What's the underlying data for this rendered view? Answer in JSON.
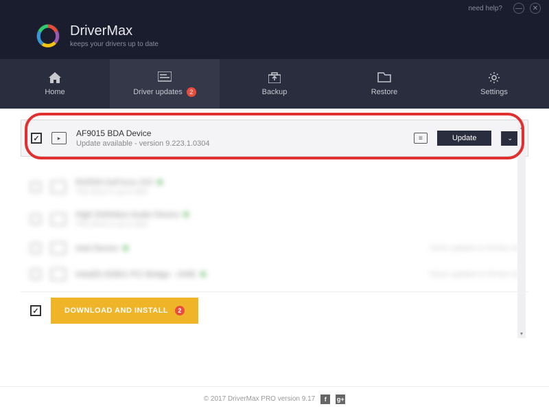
{
  "titlebar": {
    "help": "need help?"
  },
  "brand": {
    "title": "DriverMax",
    "subtitle": "keeps your drivers up to date"
  },
  "nav": {
    "items": [
      {
        "label": "Home"
      },
      {
        "label": "Driver updates",
        "badge": "2"
      },
      {
        "label": "Backup"
      },
      {
        "label": "Restore"
      },
      {
        "label": "Settings"
      }
    ]
  },
  "main_driver": {
    "name": "AF9015 BDA Device",
    "status": "Update available - version 9.223.1.0304",
    "update_label": "Update"
  },
  "blurred": [
    {
      "name": "NVIDIA GeForce 210",
      "sub": "This driver is up-to-date"
    },
    {
      "name": "High Definition Audio Device",
      "sub": "This driver is up-to-date"
    },
    {
      "name": "Intel Device",
      "sub": "",
      "right": "Driver updated on 03-Nov-16"
    },
    {
      "name": "Intel(R) 82801 PCI Bridge - 244E",
      "sub": "",
      "right": "Driver updated on 03-Nov-16"
    }
  ],
  "footer": {
    "download_label": "DOWNLOAD AND INSTALL",
    "download_badge": "2"
  },
  "bottom": {
    "copyright": "© 2017 DriverMax PRO version 9.17"
  }
}
